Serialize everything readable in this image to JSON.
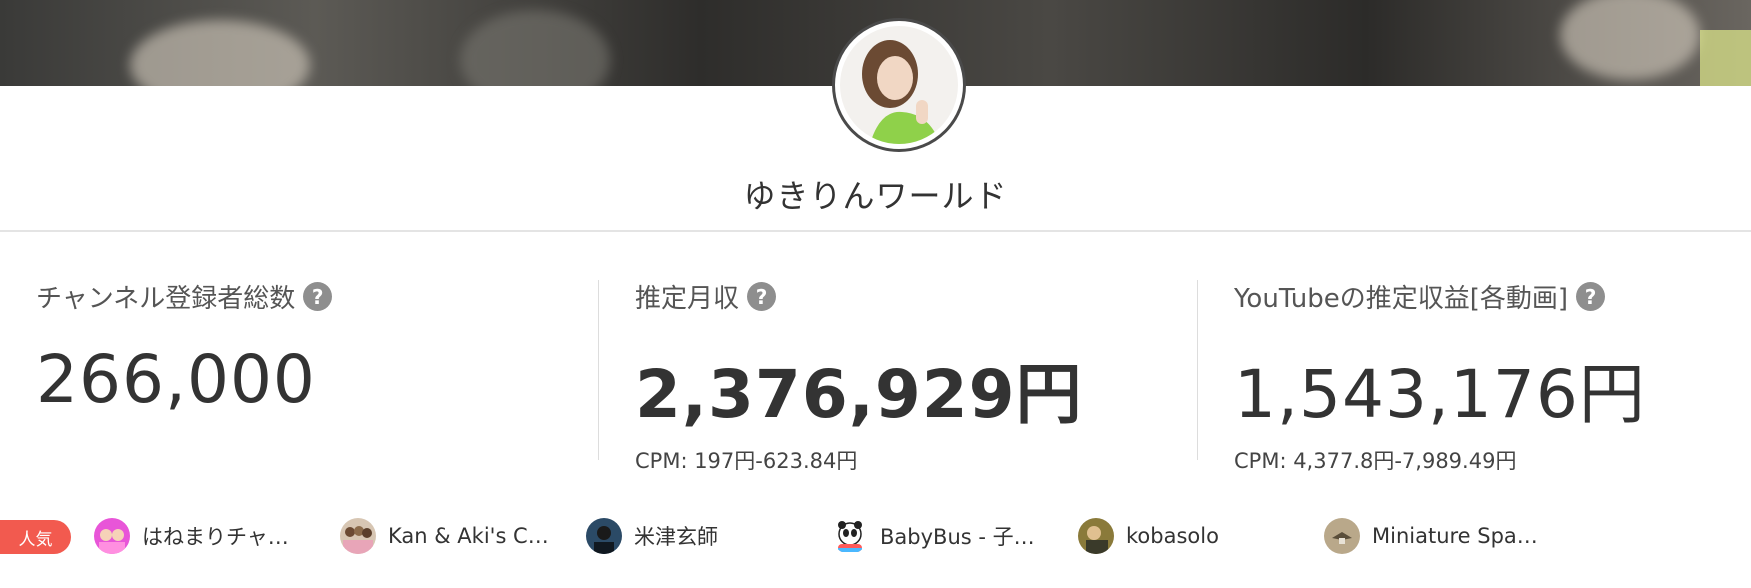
{
  "channel": {
    "name": "ゆきりんワールド"
  },
  "stats": [
    {
      "label": "チャンネル登録者総数",
      "help": "?",
      "value": "266,000",
      "sub": ""
    },
    {
      "label": "推定月収",
      "help": "?",
      "value": "2,376,929円",
      "sub": "CPM: 197円-623.84円"
    },
    {
      "label": "YouTubeの推定収益[各動画]",
      "help": "?",
      "value": "1,543,176円",
      "sub": "CPM: 4,377.8円-7,989.49円"
    }
  ],
  "related": {
    "badge": "人気",
    "badge_color": "#f25a4f",
    "channels": [
      {
        "name": "はねまりチャ…",
        "icon": "haneMari-avatar-icon",
        "color": "#e855d8"
      },
      {
        "name": "Kan & Aki's C…",
        "icon": "kan-aki-avatar-icon",
        "color": "#d7c6b3"
      },
      {
        "name": "米津玄師",
        "icon": "yonezu-avatar-icon",
        "color": "#2b4a66"
      },
      {
        "name": "BabyBus - 子…",
        "icon": "panda-avatar-icon",
        "color": "#ffffff"
      },
      {
        "name": "kobasolo",
        "icon": "kobasolo-avatar-icon",
        "color": "#8a7a3a"
      },
      {
        "name": "Miniature Spa…",
        "icon": "miniature-avatar-icon",
        "color": "#b9a88a"
      }
    ]
  }
}
